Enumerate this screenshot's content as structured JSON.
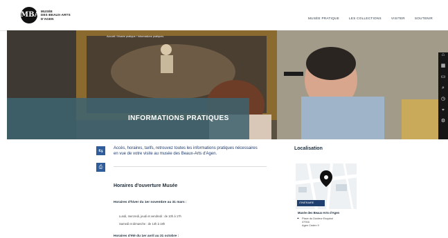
{
  "header": {
    "logo_mark": "MBA",
    "logo_lines": [
      "MUSÉE",
      "DES BEAUX-ARTS",
      "D'AGEN"
    ],
    "nav": [
      "MUSÉE PRATIQUE",
      "LES COLLECTIONS",
      "VISITER",
      "SOUTENIR"
    ]
  },
  "hero": {
    "breadcrumb": "Accueil / Musée pratique / Informations pratiques",
    "title": "INFORMATIONS PRATIQUES"
  },
  "toolbar": {
    "icons": [
      "home-icon",
      "calendar-icon",
      "ticket-icon",
      "search-icon",
      "clock-icon",
      "location-icon",
      "settings-icon"
    ]
  },
  "content": {
    "intro": "Accès, horaires, tarifs, retrouvez toutes les informations pratiques nécessaires en vue de votre visite au musée des Beaux-Arts d'Agen.",
    "section_title": "Horaires d'ouverture Musée",
    "winter_title": "Horaires d'hiver du 1er novembre au 31 mars :",
    "winter_line1": "Lundi, mercredi, jeudi et vendredi : de 10h à 17h",
    "winter_line2": "Samedi et dimanche : de 14h à 18h",
    "summer_title": "Horaires d'été du 1er avril au 31 octobre :"
  },
  "sidebar": {
    "title": "Localisation",
    "itinerary": "ITINÉRAIRE",
    "museum_name": "Musée des Beaux-Arts d'Agen",
    "address_lines": [
      "Place du Docteur Esquirol",
      "47916",
      "Agen Cedex 9"
    ]
  }
}
